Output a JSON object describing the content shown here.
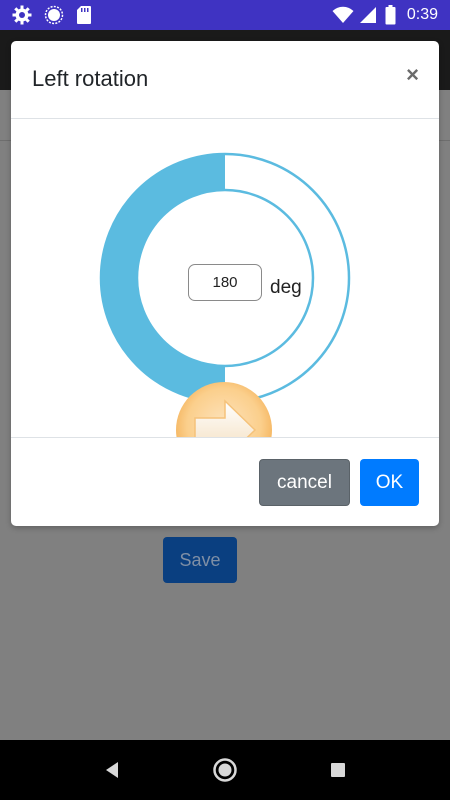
{
  "status_bar": {
    "time": "0:39",
    "background": "#3f33c2",
    "left_icons": [
      "gear-icon",
      "sync-circle-icon",
      "sd-card-icon"
    ],
    "right_icons": [
      "wifi-icon",
      "signal-icon",
      "battery-icon"
    ]
  },
  "app": {
    "save_label": "Save"
  },
  "dialog": {
    "title": "Left rotation",
    "close_glyph": "×",
    "rotation": {
      "value": "180",
      "unit": "deg",
      "progress_fraction": 0.5,
      "arc_color": "#5bbbe0",
      "handle_color": "#f7bd68"
    },
    "cancel_label": "cancel",
    "ok_label": "OK"
  },
  "colors": {
    "primary": "#007bff",
    "secondary": "#6c757d"
  }
}
